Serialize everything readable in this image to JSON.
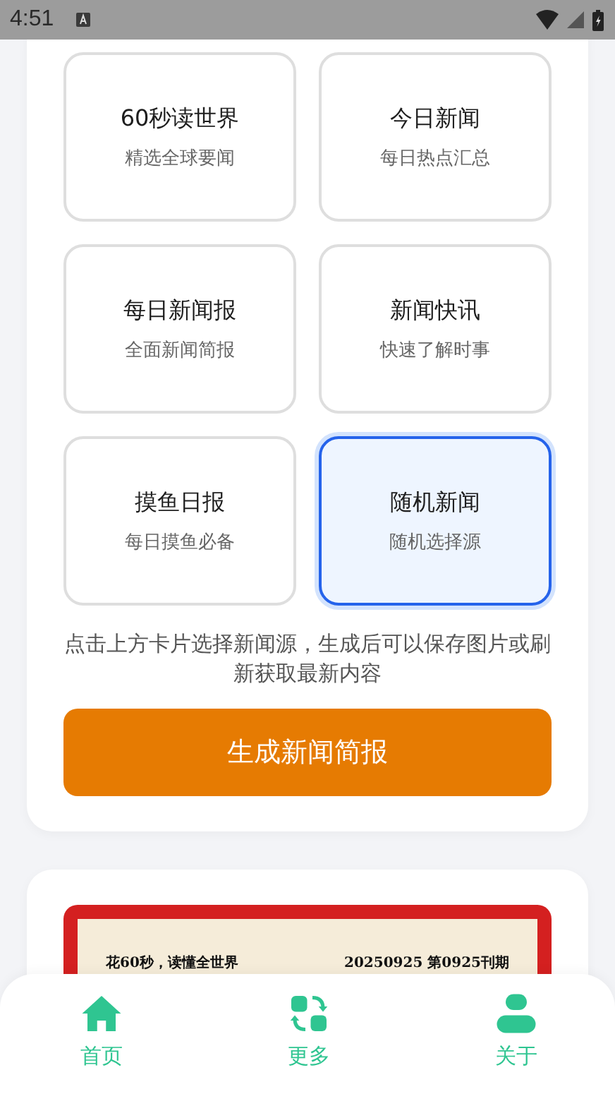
{
  "status_bar": {
    "time": "4:51"
  },
  "sources": [
    {
      "title": "60秒读世界",
      "subtitle": "精选全球要闻",
      "selected": false
    },
    {
      "title": "今日新闻",
      "subtitle": "每日热点汇总",
      "selected": false
    },
    {
      "title": "每日新闻报",
      "subtitle": "全面新闻简报",
      "selected": false
    },
    {
      "title": "新闻快讯",
      "subtitle": "快速了解时事",
      "selected": false
    },
    {
      "title": "摸鱼日报",
      "subtitle": "每日摸鱼必备",
      "selected": false
    },
    {
      "title": "随机新闻",
      "subtitle": "随机选择源",
      "selected": true
    }
  ],
  "hint": "点击上方卡片选择新闻源，生成后可以保存图片或刷新获取最新内容",
  "generate_button": "生成新闻简报",
  "preview": {
    "slogan": "花60秒，读懂全世界",
    "issue": "20250925 第0925刊期"
  },
  "nav": [
    {
      "label": "首页"
    },
    {
      "label": "更多"
    },
    {
      "label": "关于"
    }
  ]
}
